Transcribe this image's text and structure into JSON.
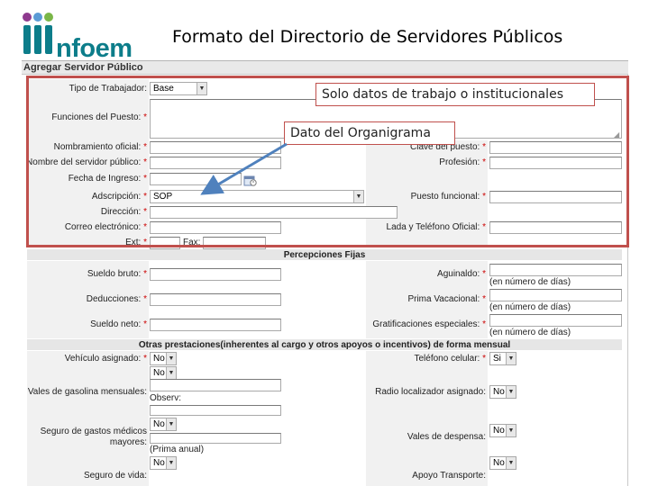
{
  "header": {
    "logo_text": "nfoem",
    "title": "Formato del Directorio de Servidores Públicos"
  },
  "form": {
    "title": "Agregar Servidor Público",
    "tipo_trabajador": {
      "label": "Tipo de Trabajador:",
      "value": "Base"
    },
    "funciones": {
      "label": "Funciones del Puesto:"
    },
    "nombramiento": {
      "label": "Nombramiento oficial:"
    },
    "clave_puesto": {
      "label": "Clave del puesto:"
    },
    "nombre": {
      "label": "Nombre del servidor público:"
    },
    "profesion": {
      "label": "Profesión:"
    },
    "fecha_ingreso": {
      "label": "Fecha de Ingreso:"
    },
    "adscripcion": {
      "label": "Adscripción:",
      "value": "SOP"
    },
    "puesto_funcional": {
      "label": "Puesto funcional:"
    },
    "direccion": {
      "label": "Dirección:"
    },
    "correo": {
      "label": "Correo electrónico:"
    },
    "lada": {
      "label": "Lada y Teléfono Oficial:"
    },
    "ext": {
      "label": "Ext:"
    },
    "fax": {
      "label": "Fax:"
    },
    "percepciones_title": "Percepciones Fijas",
    "sueldo_bruto": {
      "label": "Sueldo bruto:"
    },
    "aguinaldo": {
      "label": "Aguinaldo:",
      "hint": "(en número de días)"
    },
    "deducciones": {
      "label": "Deducciones:"
    },
    "prima_vacacional": {
      "label": "Prima Vacacional:",
      "hint": "(en número de días)"
    },
    "sueldo_neto": {
      "label": "Sueldo neto:"
    },
    "gratificaciones": {
      "label": "Gratificaciones especiales:",
      "hint": "(en número de días)"
    },
    "otras_title": "Otras prestaciones(inherentes al cargo y otros apoyos o incentivos) de forma mensual",
    "vehiculo": {
      "label": "Vehículo asignado:",
      "value": "No",
      "value2": "No"
    },
    "telefono_celular": {
      "label": "Teléfono celular:",
      "value": "Si"
    },
    "gasolina": {
      "label": "Vales de gasolina mensuales:",
      "hint": "Observ:"
    },
    "radio": {
      "label": "Radio localizador asignado:",
      "value": "No"
    },
    "seguro_gastos": {
      "label": "Seguro de gastos médicos mayores:",
      "label_line1": "Seguro de gastos médicos",
      "label_line2": "mayores:",
      "value": "No",
      "hint": "(Prima anual)"
    },
    "vales_despensa": {
      "label": "Vales de despensa:",
      "value": "No"
    },
    "seguro_vida": {
      "label": "Seguro de vida:",
      "value": "No"
    },
    "apoyo_transporte": {
      "label": "Apoyo Transporte:",
      "value": "No"
    },
    "required_mark": "*"
  },
  "annotations": {
    "box_label": "Solo datos de trabajo o institucionales",
    "arrow_label": "Dato del Organigrama",
    "accent_color": "#c0504d",
    "arrow_color": "#4f81bd"
  },
  "colors": {
    "brand": "#0c7d8a",
    "logo_accent": "#8e3a8e",
    "band": "#f1f1f1"
  }
}
